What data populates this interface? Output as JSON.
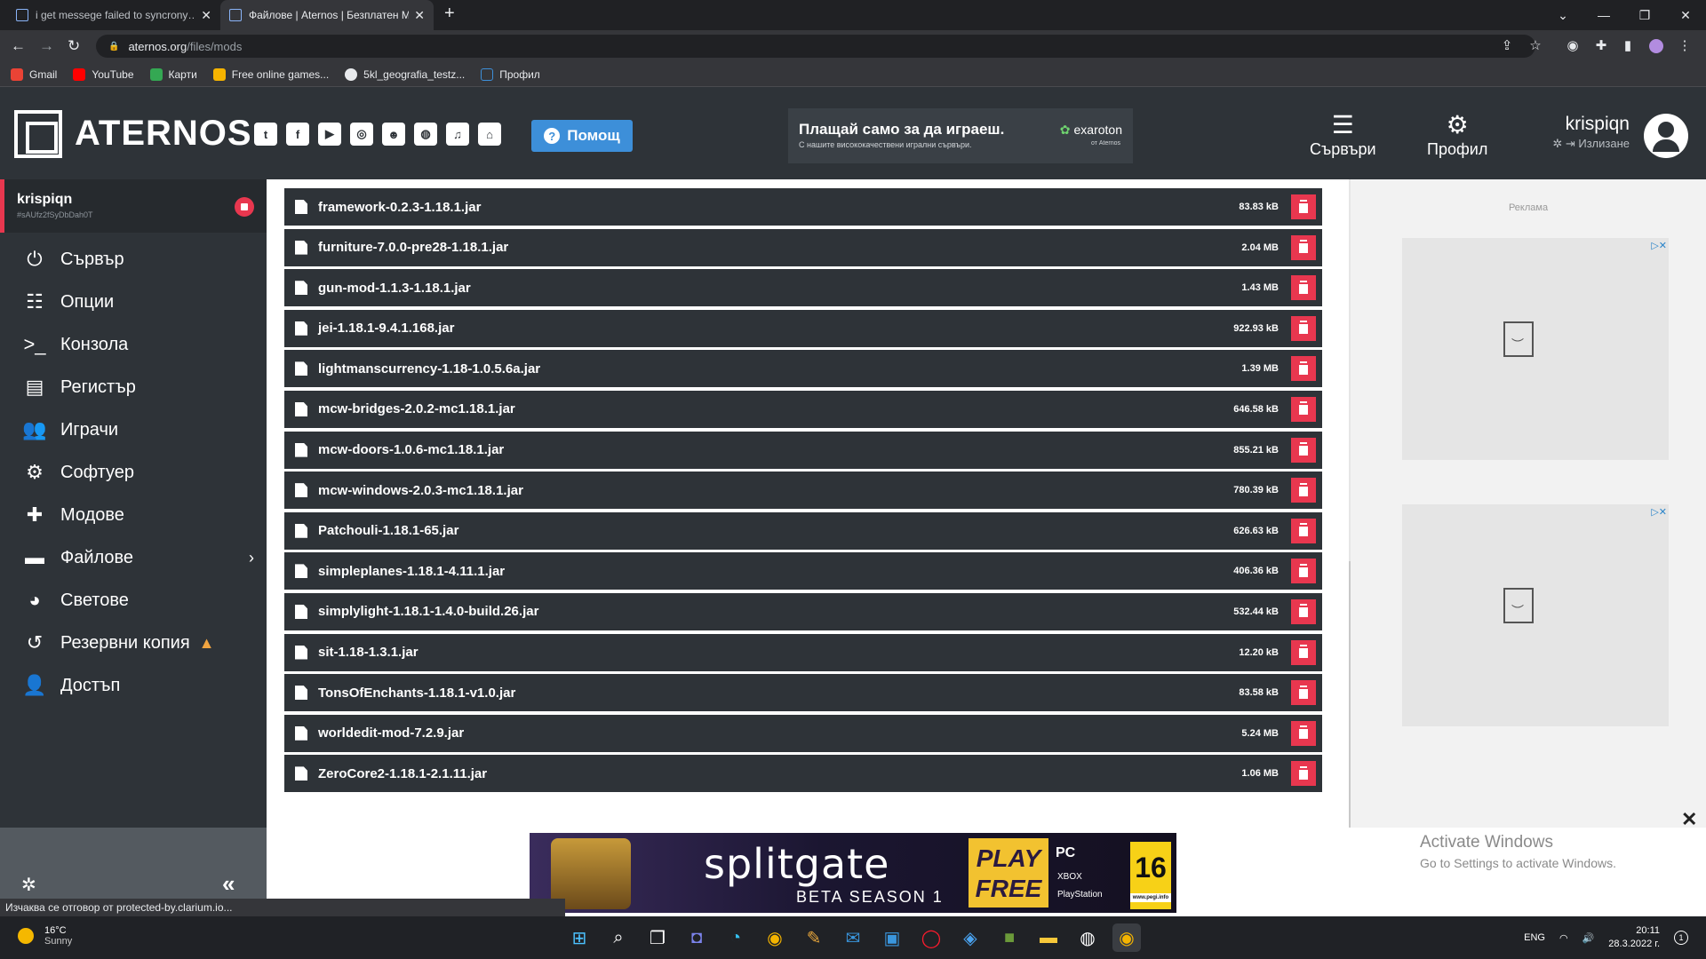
{
  "browser": {
    "tabs": [
      {
        "title": "i get messege failed to syncrony…"
      },
      {
        "title": "Файлове | Aternos | Безплатен М…"
      }
    ],
    "new_tab": "+",
    "url_host": "aternos.org",
    "url_path": "/files/mods",
    "bookmarks": [
      {
        "label": "Gmail",
        "color": "#ea4335"
      },
      {
        "label": "YouTube",
        "color": "#ff0000"
      },
      {
        "label": "Карти",
        "color": "#34a853"
      },
      {
        "label": "Free online games...",
        "color": "#f6b400"
      },
      {
        "label": "5kl_geografia_testz...",
        "color": "#e8eaed"
      },
      {
        "label": "Профил",
        "color": "#3d8fd9"
      }
    ]
  },
  "header": {
    "logo_text": "ATERNOS",
    "social_icons": [
      "twitter-icon",
      "facebook-icon",
      "youtube-icon",
      "instagram-icon",
      "reddit-icon",
      "discord-icon",
      "teamspeak-icon",
      "github-icon"
    ],
    "help_label": "Помощ",
    "promo_title": "Плащай само за да играеш.",
    "promo_sub": "С нашите висококачествени игрални сървъри.",
    "promo_brand": "exaroton",
    "promo_brand_sub": "от Aternos",
    "nav": [
      {
        "label": "Сървъри",
        "icon": "servers-icon"
      },
      {
        "label": "Профил",
        "icon": "profile-icon"
      }
    ],
    "username": "krispiqn",
    "logout_label": "Излизане"
  },
  "sidebar": {
    "server_name": "krispiqn",
    "server_id": "#sAUfz2fSyDbDah0T",
    "items": [
      {
        "label": "Сървър",
        "icon": "power-icon"
      },
      {
        "label": "Опции",
        "icon": "sliders-icon"
      },
      {
        "label": "Конзола",
        "icon": "terminal-icon"
      },
      {
        "label": "Регистър",
        "icon": "log-icon"
      },
      {
        "label": "Играчи",
        "icon": "players-icon"
      },
      {
        "label": "Софтуер",
        "icon": "software-icon"
      },
      {
        "label": "Модове",
        "icon": "puzzle-icon"
      },
      {
        "label": "Файлове",
        "icon": "folder-icon"
      },
      {
        "label": "Светове",
        "icon": "globe-icon"
      },
      {
        "label": "Резервни копия",
        "icon": "history-icon"
      },
      {
        "label": "Достъп",
        "icon": "access-icon"
      }
    ]
  },
  "files": [
    {
      "name": "framework-0.2.3-1.18.1.jar",
      "size": "83.83 kB"
    },
    {
      "name": "furniture-7.0.0-pre28-1.18.1.jar",
      "size": "2.04 MB"
    },
    {
      "name": "gun-mod-1.1.3-1.18.1.jar",
      "size": "1.43 MB"
    },
    {
      "name": "jei-1.18.1-9.4.1.168.jar",
      "size": "922.93 kB"
    },
    {
      "name": "lightmanscurrency-1.18-1.0.5.6a.jar",
      "size": "1.39 MB"
    },
    {
      "name": "mcw-bridges-2.0.2-mc1.18.1.jar",
      "size": "646.58 kB"
    },
    {
      "name": "mcw-doors-1.0.6-mc1.18.1.jar",
      "size": "855.21 kB"
    },
    {
      "name": "mcw-windows-2.0.3-mc1.18.1.jar",
      "size": "780.39 kB"
    },
    {
      "name": "Patchouli-1.18.1-65.jar",
      "size": "626.63 kB"
    },
    {
      "name": "simpleplanes-1.18.1-4.11.1.jar",
      "size": "406.36 kB"
    },
    {
      "name": "simplylight-1.18.1-1.4.0-build.26.jar",
      "size": "532.44 kB"
    },
    {
      "name": "sit-1.18-1.3.1.jar",
      "size": "12.20 kB"
    },
    {
      "name": "TonsOfEnchants-1.18.1-v1.0.jar",
      "size": "83.58 kB"
    },
    {
      "name": "worldedit-mod-7.2.9.jar",
      "size": "5.24 MB"
    },
    {
      "name": "ZeroCore2-1.18.1-2.1.11.jar",
      "size": "1.06 MB"
    }
  ],
  "ads": {
    "label": "Реклама",
    "banner_game": "splitgate",
    "banner_season": "BETA SEASON 1",
    "banner_cta": "PLAY FREE",
    "banner_platform": "PC",
    "banner_platform_2": "XBOX",
    "banner_platform_3": "PlayStation",
    "banner_rating": "16",
    "banner_rating_site": "www.pegi.info"
  },
  "activate_windows": {
    "title": "Activate Windows",
    "subtitle": "Go to Settings to activate Windows."
  },
  "status_text": "Изчаква се отговор от protected-by.clarium.io...",
  "taskbar": {
    "temperature": "16°C",
    "weather": "Sunny",
    "language": "ENG",
    "time": "20:11",
    "date": "28.3.2022 г.",
    "notifications": "1"
  }
}
